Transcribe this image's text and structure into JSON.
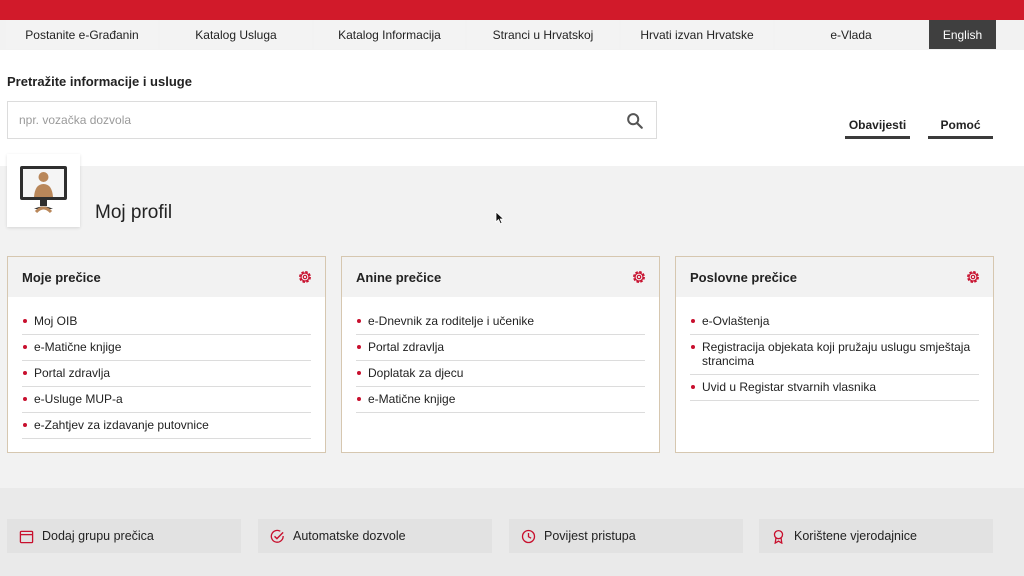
{
  "nav": {
    "items": [
      {
        "label": "Postanite e-Građanin"
      },
      {
        "label": "Katalog Usluga"
      },
      {
        "label": "Katalog Informacija"
      },
      {
        "label": "Stranci u Hrvatskoj"
      },
      {
        "label": "Hrvati izvan Hrvatske"
      },
      {
        "label": "e-Vlada"
      }
    ],
    "language": "English"
  },
  "search": {
    "title": "Pretražite informacije i usluge",
    "placeholder": "npr. vozačka dozvola",
    "value": "",
    "icon": "search-icon"
  },
  "tabs": {
    "notifications": "Obavijesti",
    "help": "Pomoć"
  },
  "profile": {
    "name": "Moj profil",
    "avatar_icon": "monitor-user-icon"
  },
  "panels": [
    {
      "title": "Moje prečice",
      "items": [
        "Moj OIB",
        "e-Matične knjige",
        "Portal zdravlja",
        "e-Usluge MUP-a",
        "e-Zahtjev za izdavanje putovnice"
      ]
    },
    {
      "title": "Anine prečice",
      "items": [
        "e-Dnevnik za roditelje i učenike",
        "Portal zdravlja",
        "Doplatak za djecu",
        "e-Matične knjige"
      ]
    },
    {
      "title": "Poslovne prečice",
      "items": [
        "e-Ovlaštenja",
        "Registracija objekata koji pružaju uslugu smještaja strancima",
        "Uvid u Registar stvarnih vlasnika"
      ]
    }
  ],
  "actions": [
    {
      "label": "Dodaj grupu prečica",
      "icon": "calendar-icon"
    },
    {
      "label": "Automatske dozvole",
      "icon": "check-circle-icon"
    },
    {
      "label": "Povijest pristupa",
      "icon": "clock-icon"
    },
    {
      "label": "Korištene vjerodajnice",
      "icon": "badge-icon"
    }
  ],
  "colors": {
    "accent": "#d11a2a",
    "bullet": "#c8102e",
    "panel_border": "#d6c7b0",
    "language_button": "#3f3f3f"
  }
}
